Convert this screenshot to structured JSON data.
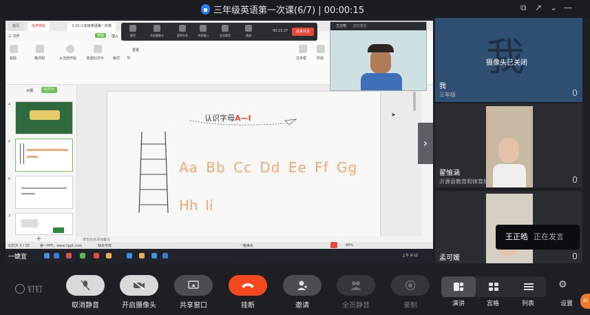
{
  "window": {
    "title": "三年级英语第一次课(6/7) | 00:00:15",
    "controls": [
      "⧉",
      "↗",
      "⌄",
      "—",
      "☐",
      "✕"
    ]
  },
  "shared_screen": {
    "wps_tabs": [
      "首页",
      "稻壳模板",
      "3.10 三年级英语第一次课"
    ],
    "menu": [
      "三 文件",
      "开始",
      "插入",
      "设计",
      "切换",
      "动画",
      "放映",
      "审阅",
      "视图",
      "工具",
      "会员专享"
    ],
    "ribbon_labels": [
      "粘贴",
      "格式刷",
      "从当前开始",
      "新建幻灯片",
      "版式",
      "节",
      "重置",
      "文本框",
      "形状"
    ],
    "meeting_bar": {
      "items": [
        "静音",
        "开启摄像头",
        "暂停共享",
        "共享窗口",
        "全员静音",
        "邀请",
        "结束共享"
      ],
      "time": "00:15:27",
      "end_button": "结束共享"
    },
    "sidebar": {
      "tab_outline": "大纲",
      "tab_slides": "幻灯片",
      "slide_numbers": [
        "4",
        "5",
        "6",
        "7"
      ],
      "add": "+"
    },
    "slide": {
      "title_prefix": "认识字母",
      "title_highlight": "A—I",
      "letters_row1": "Aa Bb Cc Dd Ee Ff Gg",
      "letters_row2": "Hh Ii"
    },
    "notes_placeholder": "单击此处添加备注",
    "status": {
      "slide_pos": "幻灯片 5 / 25",
      "theme": "第一PPT，www.1ppt.com",
      "font_missing": "缺失字体",
      "beautify": "一键美化",
      "zoom": "68%"
    },
    "taskbar": {
      "user_text": "一婕宜",
      "time": "上午 9:12"
    },
    "self_video": {
      "name": "王正皓",
      "status": "正在发言"
    }
  },
  "participants": [
    {
      "name": "我",
      "sub": "三年级",
      "avatar_char": "我",
      "camera_status": "摄像头已关闭"
    },
    {
      "name": "翟愉涵",
      "sub": "沂源县教育和体育局"
    },
    {
      "name": "孟可媛",
      "sub": ""
    }
  ],
  "speaking_toast": {
    "name": "王正皓",
    "status": "正在发言"
  },
  "toolbar": {
    "brand": "钉钉",
    "buttons": [
      {
        "label": "取消静音"
      },
      {
        "label": "开启摄像头"
      },
      {
        "label": "共享窗口"
      },
      {
        "label": "挂断"
      },
      {
        "label": "邀请"
      },
      {
        "label": "全员静音"
      },
      {
        "label": "录制"
      }
    ],
    "views": [
      "演讲",
      "宫格",
      "列表"
    ],
    "settings": "设置",
    "badge": "85"
  },
  "colors": {
    "accent_red": "#f5481e",
    "letter_orange": "#f0a877",
    "wps_green": "#6fbf5a",
    "title_red": "#e0453a"
  }
}
